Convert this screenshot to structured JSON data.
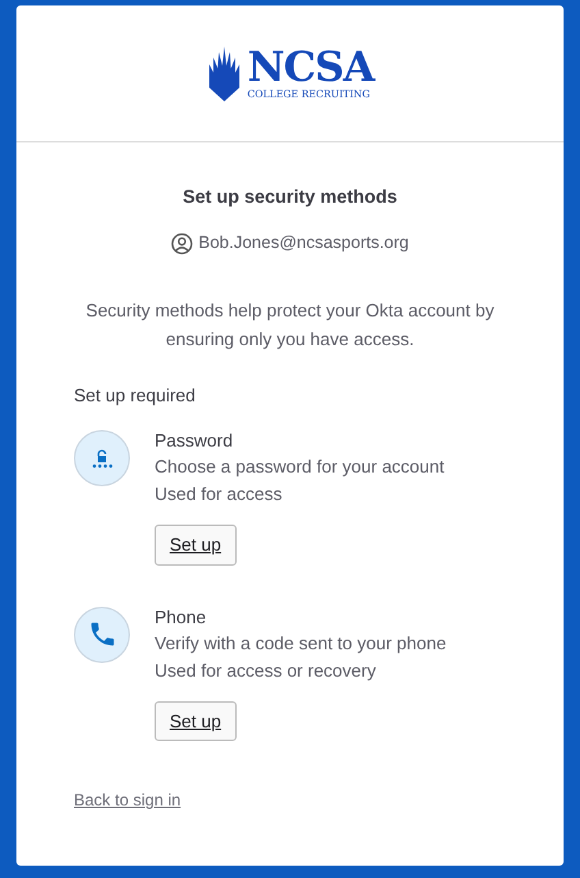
{
  "logo": {
    "name": "NCSA",
    "tagline": "COLLEGE RECRUITING"
  },
  "title": "Set up security methods",
  "user": "Bob.Jones@ncsasports.org",
  "description": "Security methods help protect your Okta account by ensuring only you have access.",
  "section_label": "Set up required",
  "methods": [
    {
      "kind": "password",
      "name": "Password",
      "lines": [
        "Choose a password for your account",
        "Used for access"
      ],
      "button": "Set up"
    },
    {
      "kind": "phone",
      "name": "Phone",
      "lines": [
        "Verify with a code sent to your phone",
        "Used for access or recovery"
      ],
      "button": "Set up"
    }
  ],
  "back_link": "Back to sign in"
}
